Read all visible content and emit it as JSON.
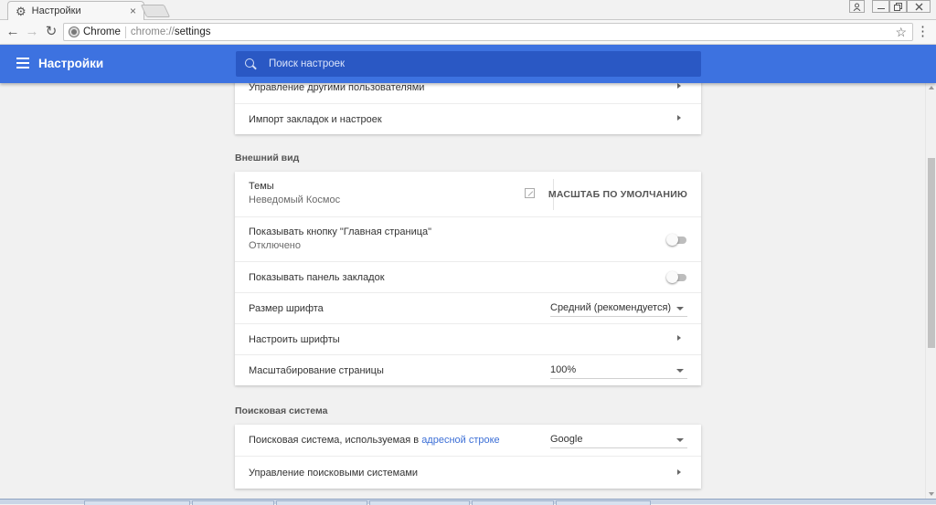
{
  "browser": {
    "tab_title": "Настройки",
    "tab_icon": "gear-icon",
    "url_chip": "Chrome",
    "url_scheme": "chrome://",
    "url_path": "settings"
  },
  "header": {
    "title": "Настройки",
    "search_placeholder": "Поиск настроек",
    "accent_color": "#3d72e0"
  },
  "people_section": {
    "items": [
      {
        "label": "Управление другими пользователями"
      },
      {
        "label": "Импорт закладок и настроек"
      }
    ]
  },
  "appearance": {
    "title": "Внешний вид",
    "theme_label": "Темы",
    "theme_value": "Неведомый Космос",
    "theme_reset": "МАСШТАБ ПО УМОЛЧАНИЮ",
    "home_button_label": "Показывать кнопку \"Главная страница\"",
    "home_button_state": "Отключено",
    "home_button_on": false,
    "bookmarks_bar_label": "Показывать панель закладок",
    "bookmarks_bar_on": false,
    "font_size_label": "Размер шрифта",
    "font_size_value": "Средний (рекомендуется)",
    "customize_fonts_label": "Настроить шрифты",
    "page_zoom_label": "Масштабирование страницы",
    "page_zoom_value": "100%"
  },
  "search_engine": {
    "title": "Поисковая система",
    "engine_label_prefix": "Поисковая система, используемая в",
    "engine_label_link": "адресной строке",
    "engine_value": "Google",
    "manage_label": "Управление поисковыми системами"
  }
}
